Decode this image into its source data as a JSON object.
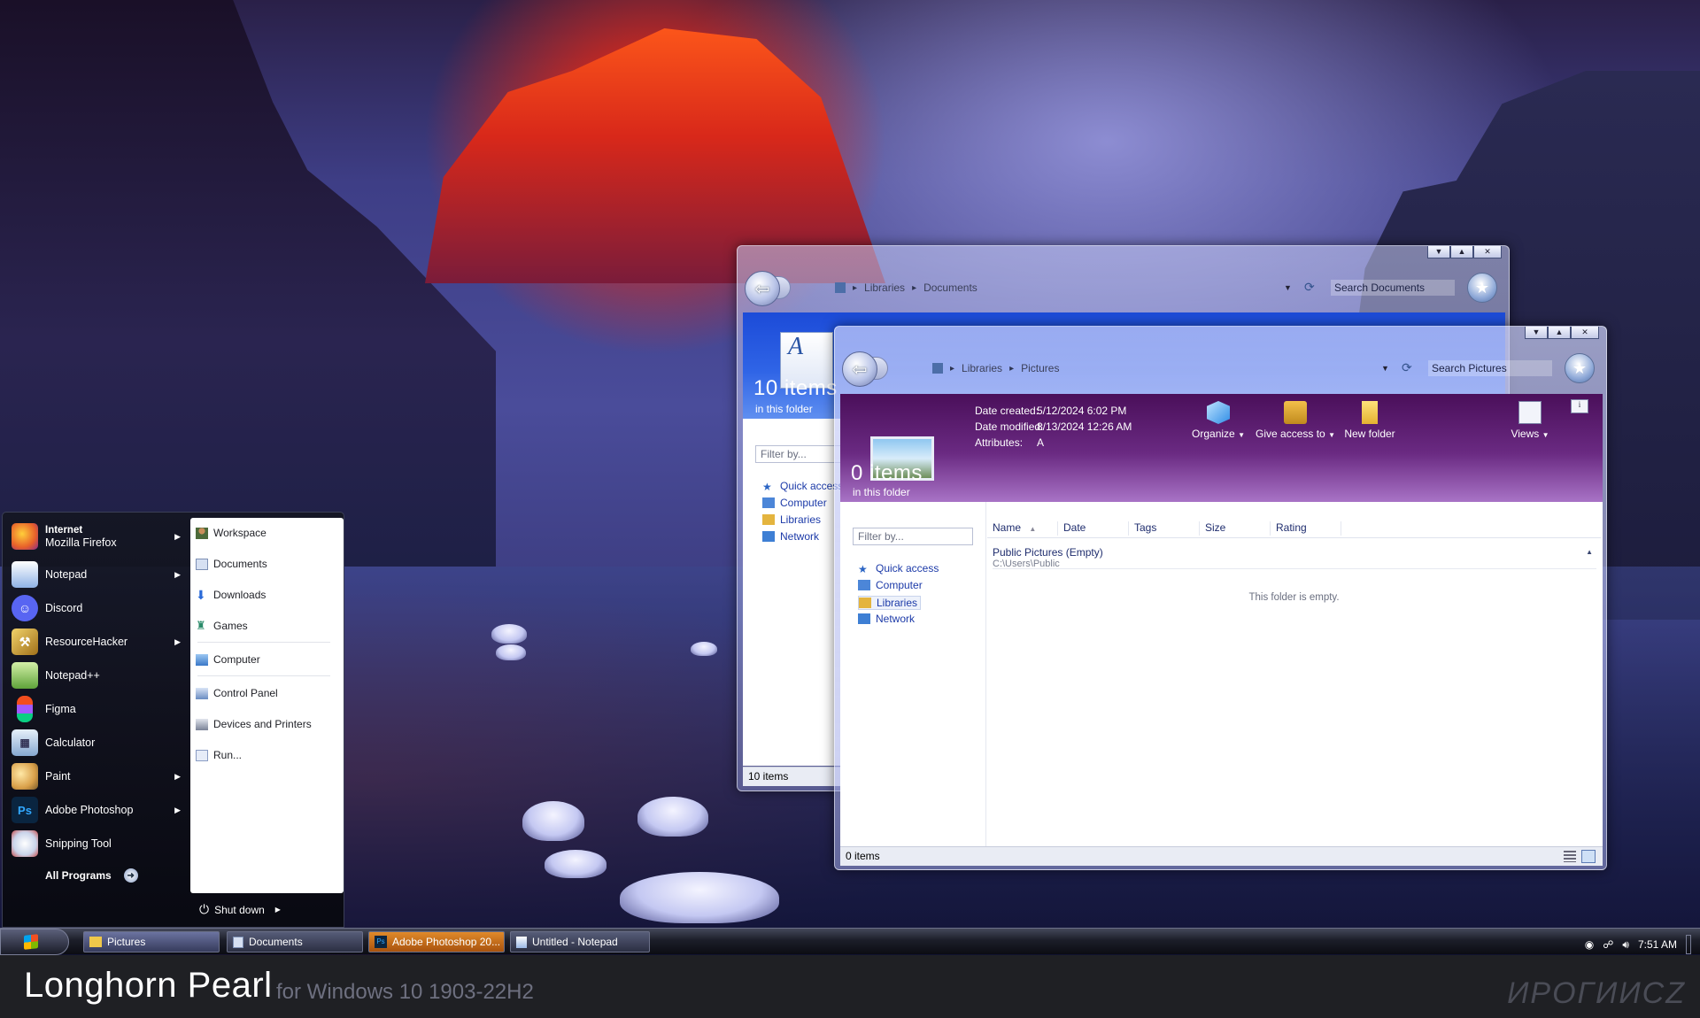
{
  "back_window": {
    "breadcrumb": [
      "Libraries",
      "Documents"
    ],
    "search_placeholder": "Search Documents",
    "header_items": "10 items",
    "header_subtitle": "in this folder",
    "filter_placeholder": "Filter by...",
    "nav": [
      "Quick access",
      "Computer",
      "Libraries",
      "Network"
    ],
    "status": "10 items"
  },
  "front_window": {
    "breadcrumb": [
      "Libraries",
      "Pictures"
    ],
    "search_placeholder": "Search Pictures",
    "header_items": "0 items",
    "header_subtitle": "in this folder",
    "details": [
      {
        "label": "Date created:",
        "value": "5/12/2024 6:02 PM"
      },
      {
        "label": "Date modified:",
        "value": "8/13/2024 12:26 AM"
      },
      {
        "label": "Attributes:",
        "value": "A"
      }
    ],
    "commands": [
      {
        "label": "Organize",
        "icon": "organize-icon",
        "dropdown": true
      },
      {
        "label": "Give access to",
        "icon": "share-people-icon",
        "dropdown": true
      },
      {
        "label": "New folder",
        "icon": "new-folder-icon",
        "dropdown": false
      }
    ],
    "views_label": "Views",
    "filter_placeholder": "Filter by...",
    "nav": [
      "Quick access",
      "Computer",
      "Libraries",
      "Network"
    ],
    "columns": [
      "Name",
      "Date",
      "Tags",
      "Size",
      "Rating"
    ],
    "group_title": "Public Pictures (Empty)",
    "group_path": "C:\\Users\\Public",
    "empty_message": "This folder is empty.",
    "status": "0 items"
  },
  "start_menu": {
    "pinned": [
      {
        "title": "Internet",
        "subtitle": "Mozilla Firefox",
        "icon": "firefox-icon",
        "color": "#e8602a",
        "arrow": true
      },
      {
        "title": "Notepad",
        "icon": "notepad-icon",
        "color": "#3f6bb8",
        "arrow": true
      },
      {
        "title": "Discord",
        "icon": "discord-icon",
        "color": "#5865f2",
        "arrow": false
      },
      {
        "title": "ResourceHacker",
        "icon": "resourcehacker-icon",
        "color": "#c99a2a",
        "arrow": true
      },
      {
        "title": "Notepad++",
        "icon": "notepadpp-icon",
        "color": "#78b34a",
        "arrow": false
      },
      {
        "title": "Figma",
        "icon": "figma-icon",
        "color": "#222222",
        "arrow": false
      },
      {
        "title": "Calculator",
        "icon": "calculator-icon",
        "color": "#8fb1d6",
        "arrow": false
      },
      {
        "title": "Paint",
        "icon": "paint-icon",
        "color": "#d9a04a",
        "arrow": true
      },
      {
        "title": "Adobe Photoshop",
        "icon": "photoshop-icon",
        "color": "#0a2540",
        "arrow": true
      },
      {
        "title": "Snipping Tool",
        "icon": "snipping-tool-icon",
        "color": "#c74a4a",
        "arrow": false
      }
    ],
    "all_programs": "All Programs",
    "right": [
      {
        "label": "Workspace",
        "icon": "user-icon"
      },
      {
        "label": "Documents",
        "icon": "documents-icon"
      },
      {
        "label": "Downloads",
        "icon": "downloads-icon"
      },
      {
        "label": "Games",
        "icon": "games-icon"
      },
      {
        "label": "Computer",
        "icon": "computer-icon"
      },
      {
        "label": "Control Panel",
        "icon": "control-panel-icon"
      },
      {
        "label": "Devices and Printers",
        "icon": "printer-icon"
      },
      {
        "label": "Run...",
        "icon": "run-icon"
      }
    ],
    "shutdown_label": "Shut down"
  },
  "taskbar": {
    "buttons": [
      {
        "label": "Pictures",
        "icon": "folder-icon"
      },
      {
        "label": "Documents",
        "icon": "documents-icon"
      },
      {
        "label": "Adobe Photoshop 20...",
        "icon": "photoshop-icon"
      },
      {
        "label": "Untitled - Notepad",
        "icon": "notepad-icon"
      }
    ],
    "clock": "7:51 AM"
  },
  "banner": {
    "title": "Longhorn Pearl",
    "subtitle": "for Windows 10 1903-22H2",
    "watermark": "ИРОГИИСZ"
  },
  "colors": {
    "accent_blue": "#1c3aa8",
    "header_purple": "#5b1e6e",
    "header_blue": "#2d5bd0"
  }
}
